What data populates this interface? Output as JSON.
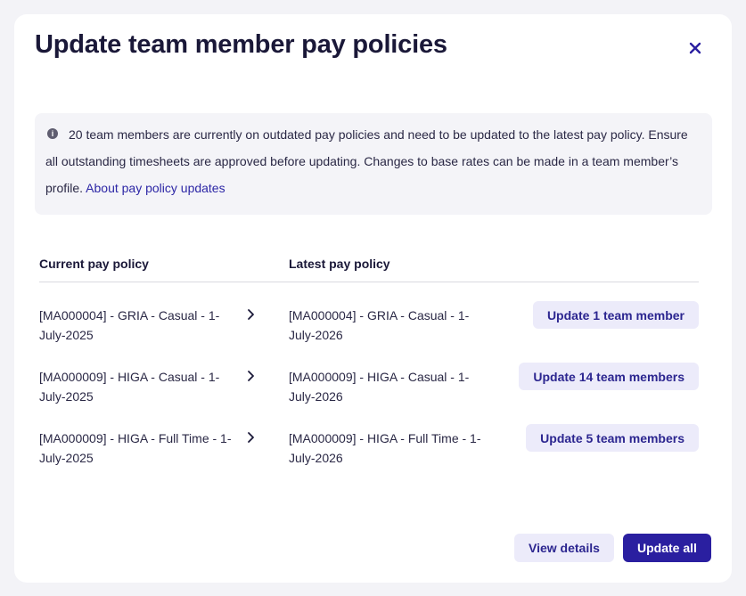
{
  "modal": {
    "title": "Update team member pay policies",
    "close_label": "×"
  },
  "notice": {
    "text": "20 team members are currently on outdated pay policies and need to be updated to the latest pay policy. Ensure all outstanding timesheets are approved before updating. Changes to base rates can be made in a team member’s profile.",
    "link_text": "About pay policy updates"
  },
  "table": {
    "headers": [
      "Current pay policy",
      "Latest pay policy"
    ],
    "rows": [
      {
        "current": "[MA000004] - GRIA - Casual - 1-July-2025",
        "latest": "[MA000004] - GRIA - Casual - 1-July-2026",
        "action": "Update 1 team member"
      },
      {
        "current": "[MA000009] - HIGA - Casual - 1-July-2025",
        "latest": "[MA000009] - HIGA - Casual - 1-July-2026",
        "action": "Update 14 team members"
      },
      {
        "current": "[MA000009] - HIGA - Full Time - 1-July-2025",
        "latest": "[MA000009] - HIGA - Full Time - 1-July-2026",
        "action": "Update 5 team members"
      }
    ]
  },
  "footer": {
    "view_details_label": "View details",
    "update_all_label": "Update all"
  },
  "colors": {
    "accent": "#2a1fa0",
    "secondary_bg": "#ecebfa",
    "notice_bg": "#f4f4f8"
  },
  "icons": [
    "info-icon",
    "close-icon",
    "chevron-right-icon"
  ]
}
